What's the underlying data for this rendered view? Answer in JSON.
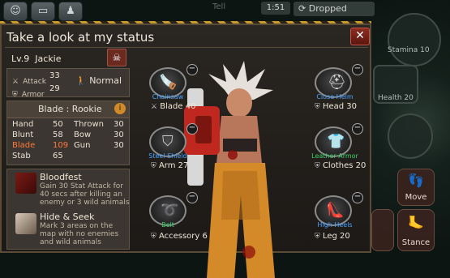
{
  "top_bar": {
    "clock": "1:51",
    "faint_text": "Tell",
    "dropped_label": "Dropped",
    "icons": [
      "smile-icon",
      "chat-icon",
      "party-icon"
    ]
  },
  "hud": {
    "stamina": "Stamina 10",
    "health": "Health 20",
    "move_label": "Move",
    "stance_label": "Stance"
  },
  "panel": {
    "title": "Take a look at my status",
    "level": "Lv.9",
    "name": "Jackie",
    "stats": {
      "attack_label": "Attack",
      "attack_value": "33",
      "armor_label": "Armor",
      "armor_value": "29",
      "stance": "Normal"
    },
    "weapon": {
      "title": "Blade : Rookie",
      "masteries": [
        {
          "label": "Hand",
          "value": "50"
        },
        {
          "label": "Thrown",
          "value": "30"
        },
        {
          "label": "Blunt",
          "value": "58"
        },
        {
          "label": "Bow",
          "value": "30"
        },
        {
          "label": "Blade",
          "value": "109"
        },
        {
          "label": "Gun",
          "value": "30"
        },
        {
          "label": "Stab",
          "value": "65"
        }
      ]
    },
    "skills": [
      {
        "name": "Bloodfest",
        "desc": "Gain 30 Stat Attack for 40 secs after killing an enemy or 3 wild animals"
      },
      {
        "name": "Hide & Seek",
        "desc": "Mark 3 areas on the map with no enemies and wild animals"
      }
    ]
  },
  "equipment": {
    "weapon": {
      "name": "Chainsaw",
      "stat": "Blade 40"
    },
    "helm": {
      "name": "Close Helm",
      "stat": "Head 30"
    },
    "shield": {
      "name": "Steel Shield",
      "stat": "Arm 27"
    },
    "armor": {
      "name": "Leather Armor",
      "stat": "Clothes 20"
    },
    "belt": {
      "name": "Belt",
      "stat": "Accessory 6"
    },
    "shoes": {
      "name": "High Heels",
      "stat": "Leg 20"
    }
  },
  "colors": {
    "equip_name": "#4aa3ff",
    "highlight_stat": "#ff7a3a",
    "hazard_yellow": "#c79a2a"
  }
}
